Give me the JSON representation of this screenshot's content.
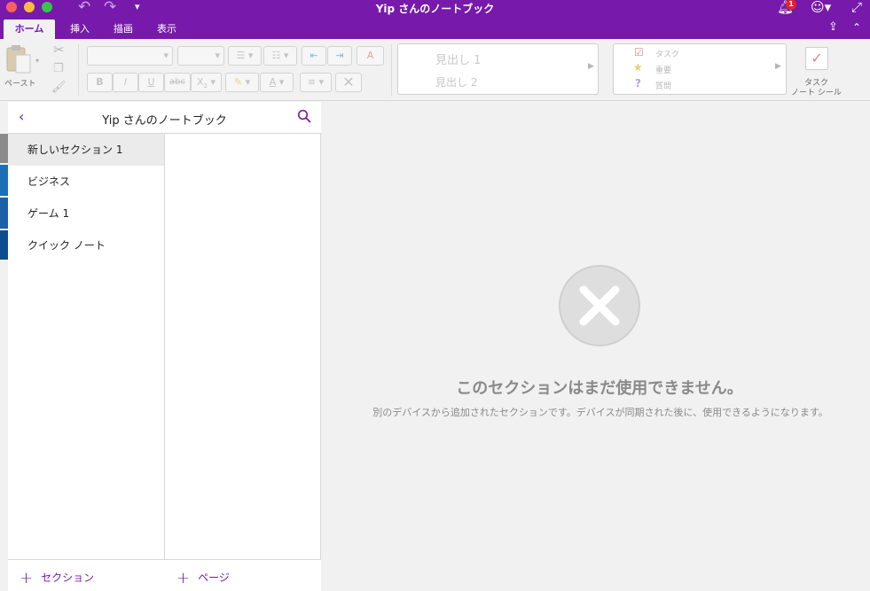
{
  "window": {
    "title": "Yip さんのノートブック",
    "notification_count": "1"
  },
  "tabs": [
    {
      "label": "ホーム"
    },
    {
      "label": "挿入"
    },
    {
      "label": "描画"
    },
    {
      "label": "表示"
    }
  ],
  "ribbon": {
    "paste_label": "ペースト",
    "bold": "B",
    "italic": "I",
    "underline": "U",
    "strikethrough": "abc",
    "subscript": "X",
    "subscript_small": "2",
    "font_color_letter": "A",
    "styles": [
      "見出し 1",
      "見出し 2"
    ],
    "tags": [
      "タスク",
      "重要",
      "質問"
    ],
    "todo_label_line1": "タスク",
    "todo_label_line2": "ノート シール"
  },
  "sidebar": {
    "notebook_title": "Yip さんのノートブック",
    "sections": [
      {
        "label": "新しいセクション 1"
      },
      {
        "label": "ビジネス"
      },
      {
        "label": "ゲーム 1"
      },
      {
        "label": "クイック ノート"
      }
    ],
    "add_section_label": "セクション",
    "add_page_label": "ページ"
  },
  "main": {
    "error_heading": "このセクションはまだ使用できません。",
    "error_description": "別のデバイスから追加されたセクションです。デバイスが同期された後に、使用できるようになります。"
  },
  "colors": {
    "brand": "#7719aa",
    "section_tabs": [
      "#8a8a8a",
      "#1e6fb8",
      "#1d5fa8",
      "#0f4d8f"
    ]
  }
}
